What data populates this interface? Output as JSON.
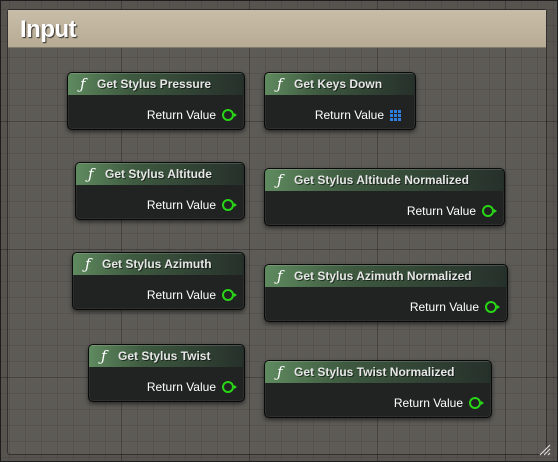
{
  "comment": {
    "title": "Input"
  },
  "nodes": [
    {
      "title": "Get Stylus Pressure",
      "pin_label": "Return Value",
      "pin_type": "float-pin-icon"
    },
    {
      "title": "Get Keys Down",
      "pin_label": "Return Value",
      "pin_type": "array-pin-icon"
    },
    {
      "title": "Get Stylus Altitude",
      "pin_label": "Return Value",
      "pin_type": "float-pin-icon"
    },
    {
      "title": "Get Stylus Altitude Normalized",
      "pin_label": "Return Value",
      "pin_type": "float-pin-icon"
    },
    {
      "title": "Get Stylus Azimuth",
      "pin_label": "Return Value",
      "pin_type": "float-pin-icon"
    },
    {
      "title": "Get Stylus Azimuth Normalized",
      "pin_label": "Return Value",
      "pin_type": "float-pin-icon"
    },
    {
      "title": "Get Stylus Twist",
      "pin_label": "Return Value",
      "pin_type": "float-pin-icon"
    },
    {
      "title": "Get Stylus Twist Normalized",
      "pin_label": "Return Value",
      "pin_type": "float-pin-icon"
    }
  ],
  "function_glyph": "ƒ",
  "colors": {
    "float_pin": "#29d617",
    "array_pin": "#2f7fe0",
    "comment_header": "#c0b49e",
    "node_header": "#5f8a5f"
  }
}
